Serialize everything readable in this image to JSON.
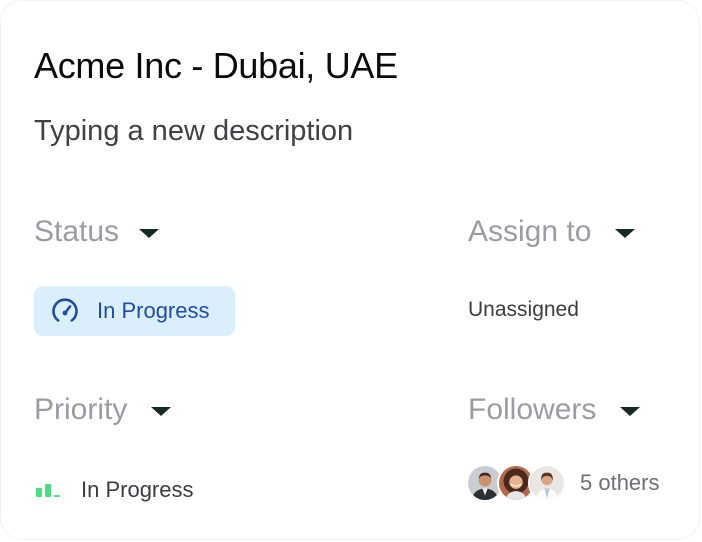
{
  "card": {
    "title": "Acme Inc - Dubai, UAE",
    "description": "Typing a new description"
  },
  "status": {
    "label": "Status",
    "value": "In Progress",
    "icon": "gauge-icon",
    "badge_color": "#dbeefb",
    "text_color": "#1f4e9e"
  },
  "assign": {
    "label": "Assign to",
    "value": "Unassigned"
  },
  "priority": {
    "label": "Priority",
    "value": "In Progress",
    "icon": "priority-bars-icon",
    "icon_color": "#4ade80"
  },
  "followers": {
    "label": "Followers",
    "avatars": [
      "avatar-man-suit",
      "avatar-woman-curly-hair",
      "avatar-woman-white-coat"
    ],
    "others_text": "5 others"
  },
  "colors": {
    "caret": "#142a22",
    "label": "#9a9ca4",
    "title": "#0b0b0c"
  }
}
